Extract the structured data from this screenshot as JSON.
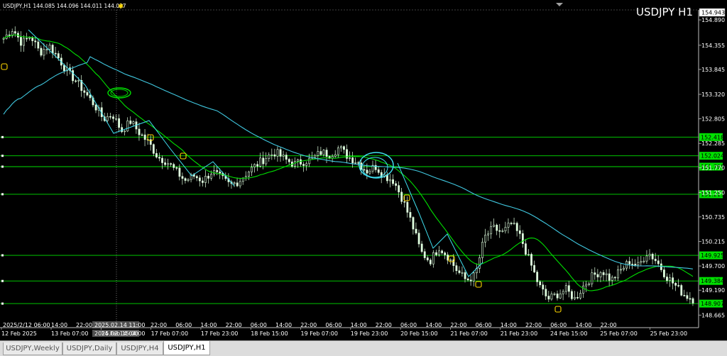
{
  "header": {
    "symbol_line": "USDJPY,H1  144.085 144.096 144.011 144.037"
  },
  "symbol_title": "USDJPY H1",
  "current_price": "154.943",
  "price_axis": [
    "154.890",
    "154.355",
    "153.845",
    "153.320",
    "152.805",
    "152.285",
    "151.770",
    "151.250",
    "150.735",
    "150.215",
    "149.700",
    "149.190",
    "148.665"
  ],
  "levels": [
    {
      "label": "152.418",
      "color": "#00e000"
    },
    {
      "label": "152.024",
      "color": "#00e000"
    },
    {
      "label": "151.795",
      "color": "#00e000"
    },
    {
      "label": "151.213",
      "color": "#00e000"
    },
    {
      "label": "149.925",
      "color": "#00e000"
    },
    {
      "label": "149.384",
      "color": "#00e000"
    },
    {
      "label": "148.907",
      "color": "#00e000"
    }
  ],
  "crosshair": {
    "top_label": "2025.02.14 11:00",
    "bottom_label": "2025.02.14 04:00"
  },
  "time_axis_top": [
    "2025/2/12 06:00",
    "14:00",
    "22:00",
    "22:00",
    "06:00",
    "14:00",
    "22:00",
    "06:00",
    "14:00",
    "22:00",
    "06:00",
    "14:00",
    "22:00",
    "06:00",
    "14:00",
    "22:00",
    "06:00",
    "14:00",
    "22:00",
    "06:00",
    "14:00",
    "22:00"
  ],
  "time_axis_bottom": [
    "12 Feb 2025",
    "13 Feb 07:00",
    "14 Feb 15:00",
    "17 Feb 07:00",
    "17 Feb 23:00",
    "18 Feb 15:00",
    "19 Feb 07:00",
    "19 Feb 23:00",
    "20 Feb 15:00",
    "21 Feb 07:00",
    "21 Feb 23:00",
    "24 Feb 15:00",
    "25 Feb 07:00",
    "25 Feb 23:00"
  ],
  "tabs": [
    {
      "label": "USDJPY,Weekly",
      "active": false
    },
    {
      "label": "USDJPY,Daily",
      "active": false
    },
    {
      "label": "USDJPY,H4",
      "active": false
    },
    {
      "label": "USDJPY,H1",
      "active": true
    }
  ],
  "colors": {
    "background": "#000000",
    "grid": "#505050",
    "candle": "#e0ffe0",
    "ma_short": "#00e000",
    "ma_long": "#40c8e0",
    "level": "#00e000",
    "marker": "#ffd800",
    "drawing_cyan": "#40e0f0"
  },
  "chart_data": {
    "type": "candlestick",
    "ylim": [
      148.4,
      155.1
    ],
    "close_path": [
      154.5,
      154.7,
      154.4,
      154.55,
      154.2,
      154.35,
      154.1,
      153.8,
      153.6,
      153.35,
      153.1,
      152.8,
      152.9,
      152.55,
      152.75,
      152.5,
      152.3,
      152.0,
      151.9,
      151.7,
      151.5,
      151.6,
      151.5,
      151.7,
      151.55,
      151.4,
      151.5,
      151.7,
      151.85,
      152.0,
      152.1,
      151.95,
      151.85,
      151.9,
      151.95,
      152.1,
      152.05,
      152.2,
      152.0,
      151.9,
      151.7,
      151.8,
      151.6,
      151.5,
      151.1,
      150.6,
      150.0,
      149.8,
      150.1,
      149.9,
      149.6,
      149.4,
      149.5,
      150.3,
      150.5,
      150.4,
      150.6,
      150.3,
      149.8,
      149.3,
      149.0,
      149.1,
      149.2,
      149.0,
      149.3,
      149.5,
      149.6,
      149.4,
      149.6,
      149.8,
      149.7,
      150.0,
      149.8,
      149.5,
      149.3,
      149.1,
      149.0
    ]
  }
}
